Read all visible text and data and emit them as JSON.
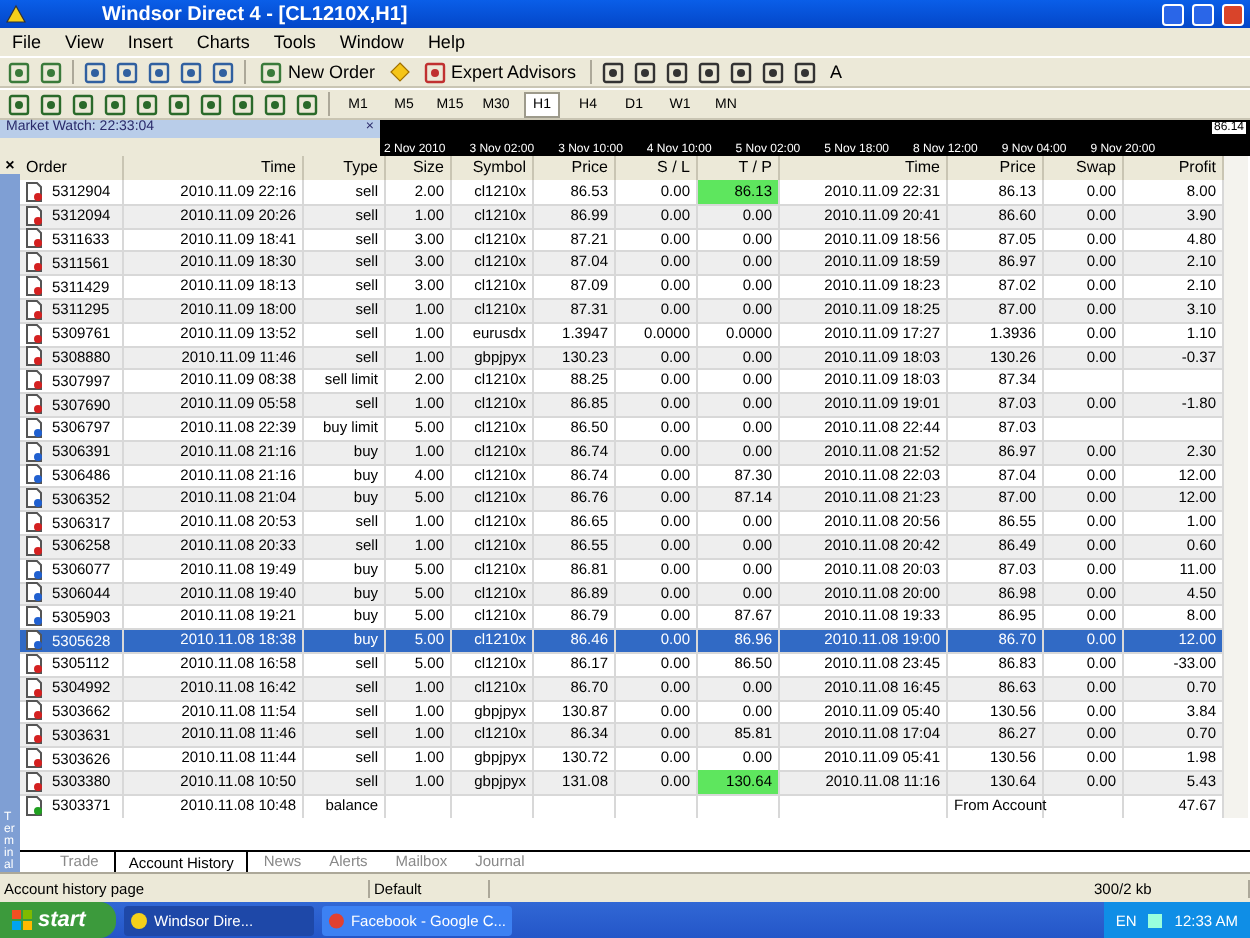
{
  "window": {
    "title": "Windsor Direct 4 - [CL1210X,H1]"
  },
  "menu": [
    "File",
    "View",
    "Insert",
    "Charts",
    "Tools",
    "Window",
    "Help"
  ],
  "toolbar": {
    "new_order": "New Order",
    "expert_advisors": "Expert Advisors",
    "text_tool": "A"
  },
  "periods": [
    {
      "label": "M1",
      "selected": false
    },
    {
      "label": "M5",
      "selected": false
    },
    {
      "label": "M15",
      "selected": false
    },
    {
      "label": "M30",
      "selected": false
    },
    {
      "label": "H1",
      "selected": true
    },
    {
      "label": "H4",
      "selected": false
    },
    {
      "label": "D1",
      "selected": false
    },
    {
      "label": "W1",
      "selected": false
    },
    {
      "label": "MN",
      "selected": false
    }
  ],
  "market_watch": {
    "title": "Market Watch: 22:33:04",
    "close": "×"
  },
  "timeline": {
    "labels": [
      "2 Nov 2010",
      "3 Nov 02:00",
      "3 Nov 10:00",
      "4 Nov 10:00",
      "5 Nov 02:00",
      "5 Nov 18:00",
      "8 Nov 12:00",
      "9 Nov 04:00",
      "9 Nov 20:00"
    ],
    "price": "86.14"
  },
  "terminal": {
    "label": "Terminal",
    "close": "×"
  },
  "table": {
    "columns": [
      "Order",
      "Time",
      "Type",
      "Size",
      "Symbol",
      "Price",
      "S / L",
      "T / P",
      "Time",
      "Price",
      "Swap",
      "Profit"
    ],
    "rows": [
      {
        "kind": "sell",
        "selected": false,
        "tp_hit": true,
        "cells": [
          "5312904",
          "2010.11.09 22:16",
          "sell",
          "2.00",
          "cl1210x",
          "86.53",
          "0.00",
          "86.13",
          "2010.11.09 22:31",
          "86.13",
          "0.00",
          "8.00"
        ]
      },
      {
        "kind": "sell",
        "selected": false,
        "tp_hit": false,
        "cells": [
          "5312094",
          "2010.11.09 20:26",
          "sell",
          "1.00",
          "cl1210x",
          "86.99",
          "0.00",
          "0.00",
          "2010.11.09 20:41",
          "86.60",
          "0.00",
          "3.90"
        ]
      },
      {
        "kind": "sell",
        "selected": false,
        "tp_hit": false,
        "cells": [
          "5311633",
          "2010.11.09 18:41",
          "sell",
          "3.00",
          "cl1210x",
          "87.21",
          "0.00",
          "0.00",
          "2010.11.09 18:56",
          "87.05",
          "0.00",
          "4.80"
        ]
      },
      {
        "kind": "sell",
        "selected": false,
        "tp_hit": false,
        "cells": [
          "5311561",
          "2010.11.09 18:30",
          "sell",
          "3.00",
          "cl1210x",
          "87.04",
          "0.00",
          "0.00",
          "2010.11.09 18:59",
          "86.97",
          "0.00",
          "2.10"
        ]
      },
      {
        "kind": "sell",
        "selected": false,
        "tp_hit": false,
        "cells": [
          "5311429",
          "2010.11.09 18:13",
          "sell",
          "3.00",
          "cl1210x",
          "87.09",
          "0.00",
          "0.00",
          "2010.11.09 18:23",
          "87.02",
          "0.00",
          "2.10"
        ]
      },
      {
        "kind": "sell",
        "selected": false,
        "tp_hit": false,
        "cells": [
          "5311295",
          "2010.11.09 18:00",
          "sell",
          "1.00",
          "cl1210x",
          "87.31",
          "0.00",
          "0.00",
          "2010.11.09 18:25",
          "87.00",
          "0.00",
          "3.10"
        ]
      },
      {
        "kind": "sell",
        "selected": false,
        "tp_hit": false,
        "cells": [
          "5309761",
          "2010.11.09 13:52",
          "sell",
          "1.00",
          "eurusdx",
          "1.3947",
          "0.0000",
          "0.0000",
          "2010.11.09 17:27",
          "1.3936",
          "0.00",
          "1.10"
        ]
      },
      {
        "kind": "sell",
        "selected": false,
        "tp_hit": false,
        "cells": [
          "5308880",
          "2010.11.09 11:46",
          "sell",
          "1.00",
          "gbpjpyx",
          "130.23",
          "0.00",
          "0.00",
          "2010.11.09 18:03",
          "130.26",
          "0.00",
          "-0.37"
        ]
      },
      {
        "kind": "sell",
        "selected": false,
        "tp_hit": false,
        "cells": [
          "5307997",
          "2010.11.09 08:38",
          "sell limit",
          "2.00",
          "cl1210x",
          "88.25",
          "0.00",
          "0.00",
          "2010.11.09 18:03",
          "87.34",
          "",
          ""
        ]
      },
      {
        "kind": "sell",
        "selected": false,
        "tp_hit": false,
        "cells": [
          "5307690",
          "2010.11.09 05:58",
          "sell",
          "1.00",
          "cl1210x",
          "86.85",
          "0.00",
          "0.00",
          "2010.11.09 19:01",
          "87.03",
          "0.00",
          "-1.80"
        ]
      },
      {
        "kind": "buy",
        "selected": false,
        "tp_hit": false,
        "cells": [
          "5306797",
          "2010.11.08 22:39",
          "buy limit",
          "5.00",
          "cl1210x",
          "86.50",
          "0.00",
          "0.00",
          "2010.11.08 22:44",
          "87.03",
          "",
          ""
        ]
      },
      {
        "kind": "buy",
        "selected": false,
        "tp_hit": false,
        "cells": [
          "5306391",
          "2010.11.08 21:16",
          "buy",
          "1.00",
          "cl1210x",
          "86.74",
          "0.00",
          "0.00",
          "2010.11.08 21:52",
          "86.97",
          "0.00",
          "2.30"
        ]
      },
      {
        "kind": "buy",
        "selected": false,
        "tp_hit": false,
        "cells": [
          "5306486",
          "2010.11.08 21:16",
          "buy",
          "4.00",
          "cl1210x",
          "86.74",
          "0.00",
          "87.30",
          "2010.11.08 22:03",
          "87.04",
          "0.00",
          "12.00"
        ]
      },
      {
        "kind": "buy",
        "selected": false,
        "tp_hit": false,
        "cells": [
          "5306352",
          "2010.11.08 21:04",
          "buy",
          "5.00",
          "cl1210x",
          "86.76",
          "0.00",
          "87.14",
          "2010.11.08 21:23",
          "87.00",
          "0.00",
          "12.00"
        ]
      },
      {
        "kind": "sell",
        "selected": false,
        "tp_hit": false,
        "cells": [
          "5306317",
          "2010.11.08 20:53",
          "sell",
          "1.00",
          "cl1210x",
          "86.65",
          "0.00",
          "0.00",
          "2010.11.08 20:56",
          "86.55",
          "0.00",
          "1.00"
        ]
      },
      {
        "kind": "sell",
        "selected": false,
        "tp_hit": false,
        "cells": [
          "5306258",
          "2010.11.08 20:33",
          "sell",
          "1.00",
          "cl1210x",
          "86.55",
          "0.00",
          "0.00",
          "2010.11.08 20:42",
          "86.49",
          "0.00",
          "0.60"
        ]
      },
      {
        "kind": "buy",
        "selected": false,
        "tp_hit": false,
        "cells": [
          "5306077",
          "2010.11.08 19:49",
          "buy",
          "5.00",
          "cl1210x",
          "86.81",
          "0.00",
          "0.00",
          "2010.11.08 20:03",
          "87.03",
          "0.00",
          "11.00"
        ]
      },
      {
        "kind": "buy",
        "selected": false,
        "tp_hit": false,
        "cells": [
          "5306044",
          "2010.11.08 19:40",
          "buy",
          "5.00",
          "cl1210x",
          "86.89",
          "0.00",
          "0.00",
          "2010.11.08 20:00",
          "86.98",
          "0.00",
          "4.50"
        ]
      },
      {
        "kind": "buy",
        "selected": false,
        "tp_hit": false,
        "cells": [
          "5305903",
          "2010.11.08 19:21",
          "buy",
          "5.00",
          "cl1210x",
          "86.79",
          "0.00",
          "87.67",
          "2010.11.08 19:33",
          "86.95",
          "0.00",
          "8.00"
        ]
      },
      {
        "kind": "buy",
        "selected": true,
        "tp_hit": false,
        "cells": [
          "5305628",
          "2010.11.08 18:38",
          "buy",
          "5.00",
          "cl1210x",
          "86.46",
          "0.00",
          "86.96",
          "2010.11.08 19:00",
          "86.70",
          "0.00",
          "12.00"
        ]
      },
      {
        "kind": "sell",
        "selected": false,
        "tp_hit": false,
        "cells": [
          "5305112",
          "2010.11.08 16:58",
          "sell",
          "5.00",
          "cl1210x",
          "86.17",
          "0.00",
          "86.50",
          "2010.11.08 23:45",
          "86.83",
          "0.00",
          "-33.00"
        ]
      },
      {
        "kind": "sell",
        "selected": false,
        "tp_hit": false,
        "cells": [
          "5304992",
          "2010.11.08 16:42",
          "sell",
          "1.00",
          "cl1210x",
          "86.70",
          "0.00",
          "0.00",
          "2010.11.08 16:45",
          "86.63",
          "0.00",
          "0.70"
        ]
      },
      {
        "kind": "sell",
        "selected": false,
        "tp_hit": false,
        "cells": [
          "5303662",
          "2010.11.08 11:54",
          "sell",
          "1.00",
          "gbpjpyx",
          "130.87",
          "0.00",
          "0.00",
          "2010.11.09 05:40",
          "130.56",
          "0.00",
          "3.84"
        ]
      },
      {
        "kind": "sell",
        "selected": false,
        "tp_hit": false,
        "cells": [
          "5303631",
          "2010.11.08 11:46",
          "sell",
          "1.00",
          "cl1210x",
          "86.34",
          "0.00",
          "85.81",
          "2010.11.08 17:04",
          "86.27",
          "0.00",
          "0.70"
        ]
      },
      {
        "kind": "sell",
        "selected": false,
        "tp_hit": false,
        "cells": [
          "5303626",
          "2010.11.08 11:44",
          "sell",
          "1.00",
          "gbpjpyx",
          "130.72",
          "0.00",
          "0.00",
          "2010.11.09 05:41",
          "130.56",
          "0.00",
          "1.98"
        ]
      },
      {
        "kind": "sell",
        "selected": false,
        "tp_hit": true,
        "cells": [
          "5303380",
          "2010.11.08 10:50",
          "sell",
          "1.00",
          "gbpjpyx",
          "131.08",
          "0.00",
          "130.64",
          "2010.11.08 11:16",
          "130.64",
          "0.00",
          "5.43"
        ]
      },
      {
        "kind": "balance",
        "selected": false,
        "tp_hit": false,
        "cells": [
          "5303371",
          "2010.11.08 10:48",
          "balance",
          "",
          "",
          "",
          "",
          "",
          "",
          "From Account",
          "",
          "47.67"
        ]
      }
    ]
  },
  "tabs": [
    {
      "label": "Trade",
      "selected": false
    },
    {
      "label": "Account History",
      "selected": true
    },
    {
      "label": "News",
      "selected": false
    },
    {
      "label": "Alerts",
      "selected": false
    },
    {
      "label": "Mailbox",
      "selected": false
    },
    {
      "label": "Journal",
      "selected": false
    }
  ],
  "status_bar": {
    "left": "Account history page",
    "profile": "Default",
    "traffic": "300/2 kb"
  },
  "taskbar": {
    "start": "start",
    "tasks": [
      {
        "label": "Windsor Dire...",
        "selected": true
      },
      {
        "label": "Facebook - Google C...",
        "selected": false
      }
    ],
    "language": "EN",
    "clock": "12:33 AM"
  }
}
